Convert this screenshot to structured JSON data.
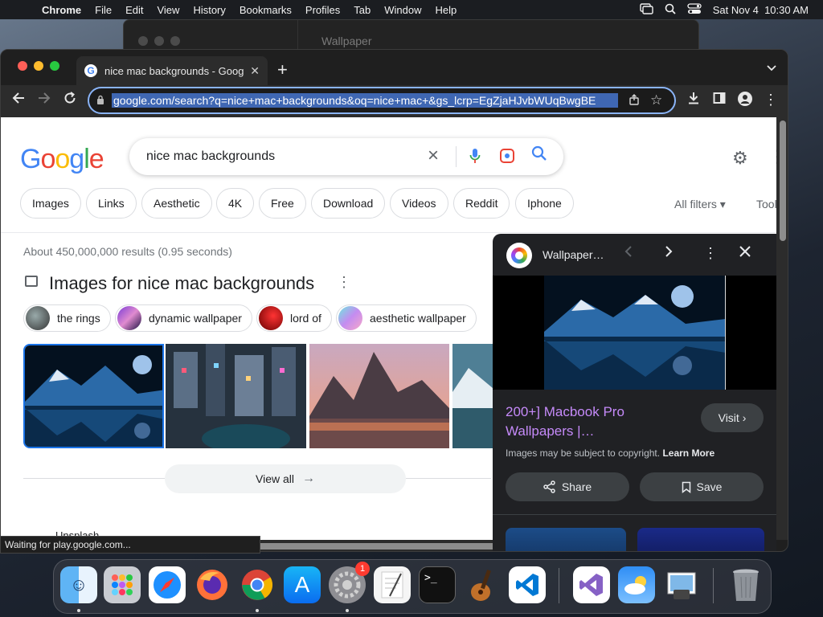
{
  "menubar": {
    "app": "Chrome",
    "items": [
      "File",
      "Edit",
      "View",
      "History",
      "Bookmarks",
      "Profiles",
      "Tab",
      "Window",
      "Help"
    ],
    "datetime": "Sat Nov 4  10:30 AM"
  },
  "background_window": {
    "title": "Wallpaper"
  },
  "browser": {
    "tab_title": "nice mac backgrounds - Goog",
    "url": "google.com/search?q=nice+mac+backgrounds&oq=nice+mac+&gs_lcrp=EgZjaHJvbWUqBwgBE"
  },
  "search": {
    "logo": [
      "G",
      "o",
      "o",
      "g",
      "l",
      "e"
    ],
    "query": "nice mac backgrounds",
    "filters": [
      "Images",
      "Links",
      "Aesthetic",
      "4K",
      "Free",
      "Download",
      "Videos",
      "Reddit",
      "Iphone"
    ],
    "all_filters": "All filters",
    "tools": "Tools",
    "stats": "About 450,000,000 results (0.95 seconds)",
    "images_heading": "Images for nice mac backgrounds",
    "related": [
      "the rings",
      "dynamic wallpaper",
      "lord of",
      "aesthetic wallpaper"
    ],
    "view_all": "View all",
    "partial_text": "Unsplash"
  },
  "panel": {
    "source": "Wallpaper…",
    "title": "200+] Macbook Pro Wallpapers |…",
    "visit": "Visit",
    "copyright": "Images may be subject to copyright.",
    "learn_more": "Learn More",
    "share": "Share",
    "save": "Save"
  },
  "status": "Waiting for play.google.com...",
  "dock": {
    "settings_badge": "1",
    "apps": [
      "Finder",
      "Launchpad",
      "Safari",
      "Firefox",
      "Chrome",
      "App Store",
      "System Settings",
      "TextEdit",
      "Terminal",
      "GarageBand",
      "VS Code",
      "Visual Studio",
      "Weather",
      "Preview",
      "Trash"
    ]
  },
  "colors": {
    "accent": "#8ab4f8",
    "panel_title": "#c58af9",
    "badge": "#ff3b30"
  }
}
